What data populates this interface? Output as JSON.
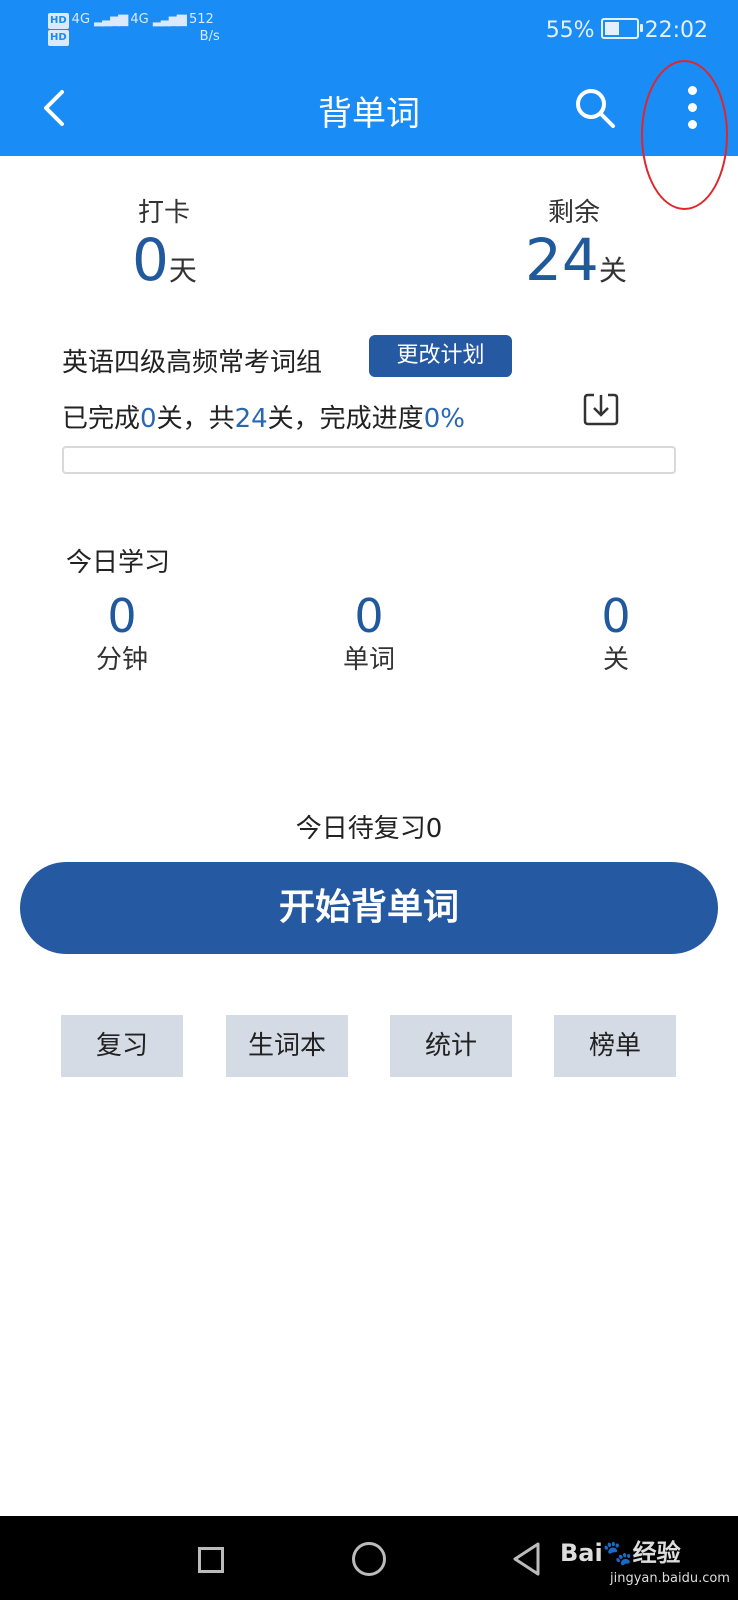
{
  "status_bar": {
    "hd1": "HD",
    "hd2": "HD",
    "network": "4G",
    "network2": "4G",
    "speed": "512",
    "speed_unit": "B/s",
    "battery": "55%",
    "battery_level": 0.55,
    "time": "22:02"
  },
  "header": {
    "title": "背单词",
    "back_icon": "chevron-left-icon",
    "search_icon": "search-icon",
    "more_icon": "more-vertical-icon"
  },
  "checkin": {
    "label": "打卡",
    "value": "0",
    "unit": "天"
  },
  "remaining": {
    "label": "剩余",
    "value": "24",
    "unit": "关"
  },
  "plan": {
    "name": "英语四级高频常考词组",
    "change_button": "更改计划",
    "progress_prefix": "已完成",
    "completed": "0",
    "unit1": "关，共",
    "total": "24",
    "unit2": "关，完成进度",
    "percent": "0%",
    "progress_fraction": 0,
    "download_icon": "download-icon"
  },
  "today": {
    "title": "今日学习",
    "stats": [
      {
        "value": "0",
        "label": "分钟"
      },
      {
        "value": "0",
        "label": "单词"
      },
      {
        "value": "0",
        "label": "关"
      }
    ]
  },
  "review_pending": "今日待复习0",
  "start_button": "开始背单词",
  "bottom_buttons": [
    "复习",
    "生词本",
    "统计",
    "榜单"
  ],
  "watermark": {
    "brand": "Bai",
    "brand2": "经验",
    "url": "jingyan.baidu.com"
  },
  "colors": {
    "header_bg": "#1a8cf6",
    "primary": "#2559a2",
    "number": "#21599d",
    "annotation": "#e0262b"
  }
}
